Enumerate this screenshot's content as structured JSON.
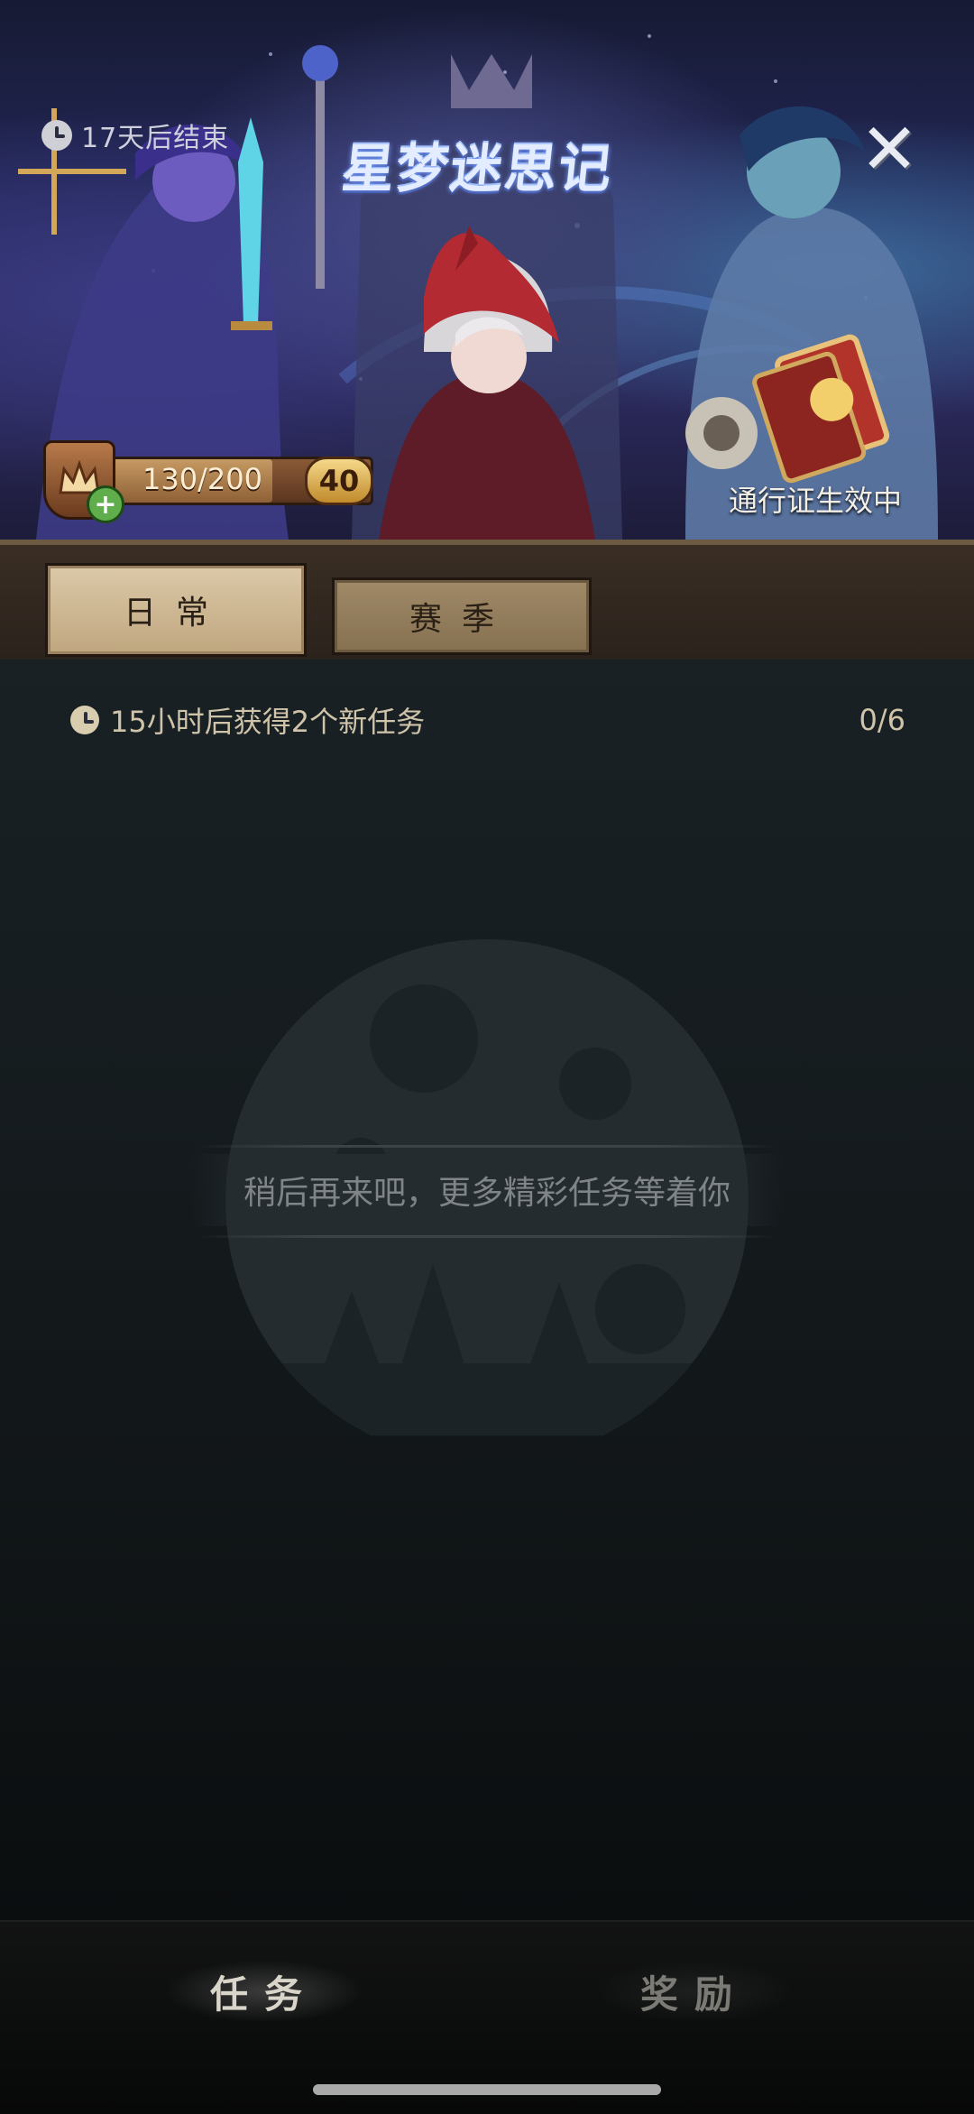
{
  "banner": {
    "timer_text": "17天后结束",
    "event_title": "星梦迷思记",
    "pass_status": "通行证生效中",
    "close_icon": "close-x-icon"
  },
  "level": {
    "xp_text": "130/200",
    "xp_progress": 0.65,
    "level_value": "40",
    "crown_icon": "crown-icon",
    "plus_icon": "plus-icon"
  },
  "tabs": [
    {
      "label": "日常",
      "active": true
    },
    {
      "label": "赛季",
      "active": false
    }
  ],
  "tasks": {
    "refresh_text": "15小时后获得2个新任务",
    "count_text": "0/6",
    "empty_message": "稍后再来吧，更多精彩任务等着你"
  },
  "bottom_nav": [
    {
      "label": "任务",
      "active": true
    },
    {
      "label": "奖励",
      "active": false
    }
  ],
  "colors": {
    "background": "#0c1113",
    "tab_active": "#d3bf9c",
    "accent_gold": "#e2bd6b"
  }
}
